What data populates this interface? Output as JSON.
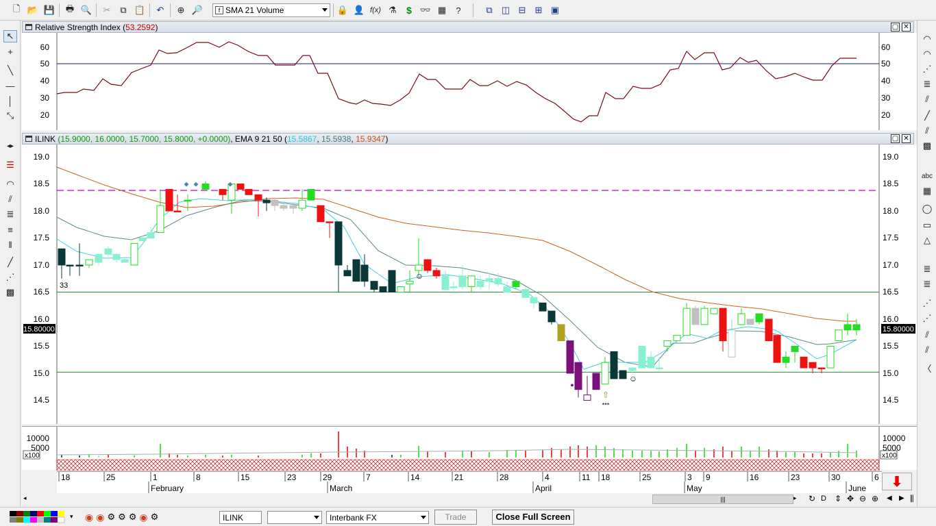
{
  "toolbar": {
    "indicator_dropdown": "SMA 21 Volume",
    "dollar_symbol": "$",
    "fx_symbol": "f(x)"
  },
  "rsi_pane": {
    "title_prefix": "Relative Strength Index (",
    "value": "53.2592",
    "title_suffix": ")",
    "y_ticks": [
      "60",
      "50",
      "40",
      "30",
      "20"
    ]
  },
  "price_pane": {
    "symbol": "ILINK",
    "ohlc": "(15.9000, 16.0000, 15.7000, 15.8000, +0.0000)",
    "ema_label": "EMA 9 21 50 (",
    "ema9": "15.5867",
    "ema21": "15.5938",
    "ema50": "15.9347",
    "ema_suffix": ")",
    "y_ticks": [
      "19.0",
      "18.5",
      "18.0",
      "17.5",
      "17.0",
      "16.5",
      "16.0",
      "15.5",
      "15.0",
      "14.5"
    ],
    "current_price": "15.80000",
    "count_label": "33",
    "stars_label": "***",
    "colors": {
      "ema9": "#40d0e0",
      "ema21": "#5a8a8a",
      "ema50": "#d06020",
      "up": "#22dd22",
      "down": "#ee1111",
      "dark": "#0a3838",
      "purple": "#7a107a",
      "light": "#88f0d0",
      "gray": "#c0c0c0",
      "olive": "#b0a020",
      "dashed": "#cc00cc",
      "hline": "#228833"
    }
  },
  "volume_pane": {
    "y_ticks": [
      "10000",
      "5000"
    ],
    "multiplier": "x100"
  },
  "date_axis": {
    "days": [
      "18",
      "25",
      "1",
      "8",
      "15",
      "23",
      "29",
      "7",
      "14",
      "21",
      "28",
      "4",
      "11",
      "18",
      "25",
      "3",
      "9",
      "16",
      "23",
      "30",
      "6"
    ],
    "months": [
      "February",
      "March",
      "April",
      "May",
      "June"
    ]
  },
  "status_bar": {
    "symbol_field": "ILINK",
    "empty_select": "",
    "feed_select": "Interbank FX",
    "trade_button": "Trade",
    "close_fullscreen_button": "Close Full Screen"
  }
}
